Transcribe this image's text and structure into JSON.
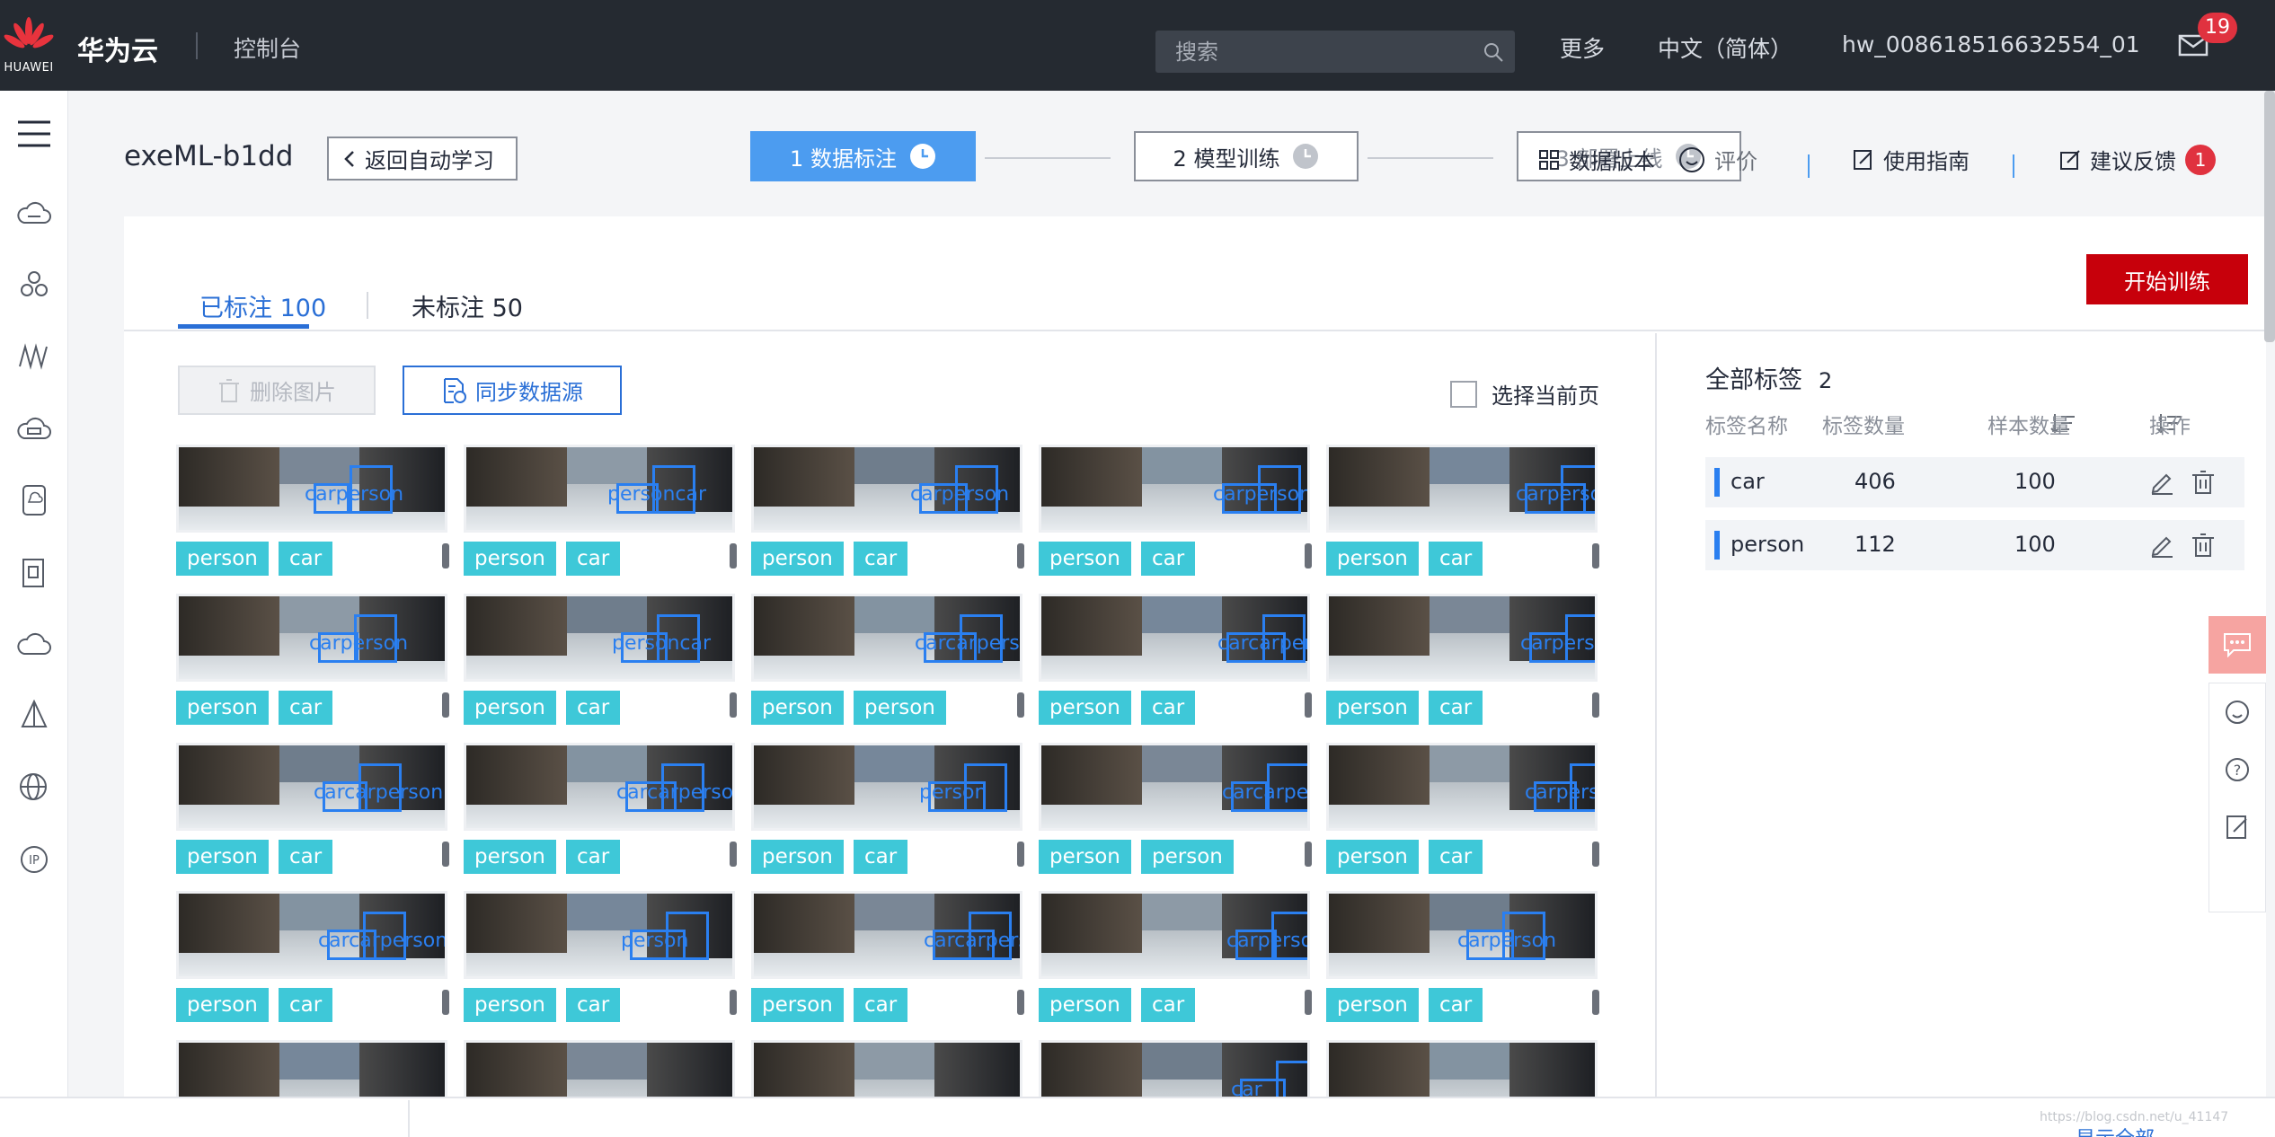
{
  "topbar": {
    "logo_text": "HUAWEI",
    "brand": "华为云",
    "console": "控制台",
    "search_placeholder": "搜索",
    "more": "更多",
    "language": "中文（简体）",
    "username": "hw_008618516632554_01",
    "mail_count": "19"
  },
  "project": {
    "title": "exeML-b1dd",
    "back_label": "返回自动学习",
    "steps": [
      "1 数据标注",
      "2 模型训练",
      "3 部署上线"
    ]
  },
  "head_actions": {
    "dataset_version": "数据版本",
    "rate": "评价",
    "guide": "使用指南",
    "feedback": "建议反馈",
    "feedback_count": "1"
  },
  "tabs": {
    "labeled": "已标注 100",
    "unlabeled": "未标注 50"
  },
  "toolbar": {
    "train": "开始训练",
    "delete": "删除图片",
    "sync": "同步数据源",
    "select_page": "选择当前页"
  },
  "labels_panel": {
    "title": "全部标签",
    "count": "2",
    "headers": [
      "标签名称",
      "标签数量",
      "样本数量",
      "操作"
    ],
    "rows": [
      {
        "name": "car",
        "label_count": "406",
        "sample_count": "100"
      },
      {
        "name": "person",
        "label_count": "112",
        "sample_count": "100"
      }
    ]
  },
  "images": [
    {
      "tags": [
        "person",
        "car"
      ],
      "box_text": "carperson"
    },
    {
      "tags": [
        "person",
        "car"
      ],
      "box_text": "personcar"
    },
    {
      "tags": [
        "person",
        "car"
      ],
      "box_text": "carperson"
    },
    {
      "tags": [
        "person",
        "car"
      ],
      "box_text": "carperson"
    },
    {
      "tags": [
        "person",
        "car"
      ],
      "box_text": "carperson"
    },
    {
      "tags": [
        "person",
        "car"
      ],
      "box_text": "carperson"
    },
    {
      "tags": [
        "person",
        "car"
      ],
      "box_text": "personcar"
    },
    {
      "tags": [
        "person",
        "person"
      ],
      "box_text": "carcarperson"
    },
    {
      "tags": [
        "person",
        "car"
      ],
      "box_text": "carcarperson"
    },
    {
      "tags": [
        "person",
        "car"
      ],
      "box_text": "carperson"
    },
    {
      "tags": [
        "person",
        "car"
      ],
      "box_text": "carcarperson"
    },
    {
      "tags": [
        "person",
        "car"
      ],
      "box_text": "carcarperson"
    },
    {
      "tags": [
        "person",
        "car"
      ],
      "box_text": "person"
    },
    {
      "tags": [
        "person",
        "person"
      ],
      "box_text": "carcarperson"
    },
    {
      "tags": [
        "person",
        "car"
      ],
      "box_text": "carperson"
    },
    {
      "tags": [
        "person",
        "car"
      ],
      "box_text": "carcarperson"
    },
    {
      "tags": [
        "person",
        "car"
      ],
      "box_text": "person"
    },
    {
      "tags": [
        "person",
        "car"
      ],
      "box_text": "carcarperson"
    },
    {
      "tags": [
        "person",
        "car"
      ],
      "box_text": "carperson"
    },
    {
      "tags": [
        "person",
        "car"
      ],
      "box_text": "carperson"
    },
    {
      "tags": [],
      "box_text": ""
    },
    {
      "tags": [],
      "box_text": ""
    },
    {
      "tags": [],
      "box_text": ""
    },
    {
      "tags": [],
      "box_text": "car"
    },
    {
      "tags": [],
      "box_text": ""
    }
  ],
  "bottom": {
    "show_all": "显示全部",
    "watermark": "https://blog.csdn.net/u_41147"
  },
  "colors": {
    "topbar": "#252a31",
    "accent": "#2a6fd6",
    "step_active": "#4c9cf0",
    "train_button": "#c7000b",
    "tag": "#3ec8d8",
    "bbox": "#2a7ff0"
  }
}
